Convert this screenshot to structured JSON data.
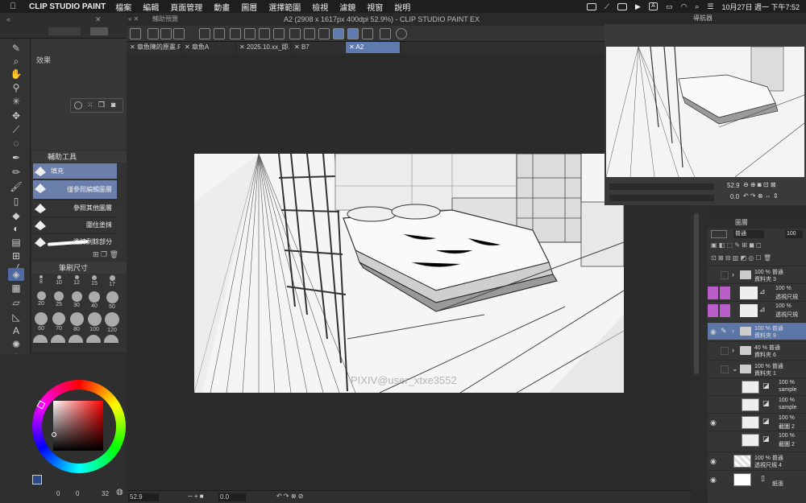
{
  "menubar": {
    "apple": "",
    "app": "CLIP STUDIO PAINT",
    "items": [
      "檔案",
      "編輯",
      "頁面管理",
      "動畫",
      "圖層",
      "選擇範圍",
      "檢視",
      "濾鏡",
      "視窗",
      "說明"
    ],
    "clock": "10月27日 週一 下午7:52"
  },
  "window": {
    "doc_title": "A2 (2908 x 1617px 400dpi 52.9%) - CLIP STUDIO PAINT EX",
    "aux_title": "輔助預覽",
    "nav_title": "導航器"
  },
  "tabs": [
    {
      "label": "章魚陳的原畫.F..."
    },
    {
      "label": "章魚A"
    },
    {
      "label": "2025.10.xx_即..."
    },
    {
      "label": "B7"
    },
    {
      "label": "A2"
    }
  ],
  "effect_panel": {
    "label": "效果"
  },
  "subtool": {
    "title": "輔助工具",
    "items": [
      "填充",
      "僅參照編輯圖層",
      "參照其他圖層",
      "圍住塗抹",
      "塗抹剩餘部分"
    ]
  },
  "brush_size": {
    "title": "筆刷尺寸",
    "sizes": [
      "8",
      "10",
      "12",
      "15",
      "17",
      "20",
      "25",
      "30",
      "40",
      "50",
      "60",
      "70",
      "80",
      "100",
      "120"
    ]
  },
  "artwork": {
    "watermark": "PIXIV@user_xtxe3552"
  },
  "navigator": {
    "zoom": "52.9",
    "rotate": "0.0"
  },
  "statusbar": {
    "zoom": "52.9",
    "rotate": "0.0"
  },
  "color": {
    "counts": [
      "0",
      "0",
      "32"
    ]
  },
  "layers_panel": {
    "title": "圖層",
    "blend": "普通",
    "opacity": "100"
  },
  "layers": [
    {
      "opacity": "100 %",
      "blend": "普通",
      "name": "資料夾 3",
      "type": "folder"
    },
    {
      "opacity": "100 %",
      "blend": "",
      "name": "透視尺規",
      "type": "ruler"
    },
    {
      "opacity": "100 %",
      "blend": "",
      "name": "透視尺規",
      "type": "ruler"
    },
    {
      "opacity": "100 %",
      "blend": "普通",
      "name": "資料夾 9",
      "type": "folder"
    },
    {
      "opacity": "40 %",
      "blend": "普通",
      "name": "資料夾 6",
      "type": "folder"
    },
    {
      "opacity": "100 %",
      "blend": "普通",
      "name": "資料夾 1",
      "type": "folder"
    },
    {
      "opacity": "100 %",
      "blend": "",
      "name": "sample",
      "type": "img"
    },
    {
      "opacity": "100 %",
      "blend": "",
      "name": "sample",
      "type": "img"
    },
    {
      "opacity": "100 %",
      "blend": "",
      "name": "截圖 2",
      "type": "img"
    },
    {
      "opacity": "100 %",
      "blend": "",
      "name": "截圖 2",
      "type": "img"
    },
    {
      "opacity": "100 %",
      "blend": "普通",
      "name": "透視尺規 4",
      "type": "img"
    },
    {
      "opacity": "",
      "blend": "",
      "name": "紙張",
      "type": "paper"
    }
  ],
  "colors": {
    "accent": "#5e7bb0",
    "folder_pink": "#b95ec9",
    "main_color": "#1a1a1a",
    "sub_color": "#ffffff"
  }
}
